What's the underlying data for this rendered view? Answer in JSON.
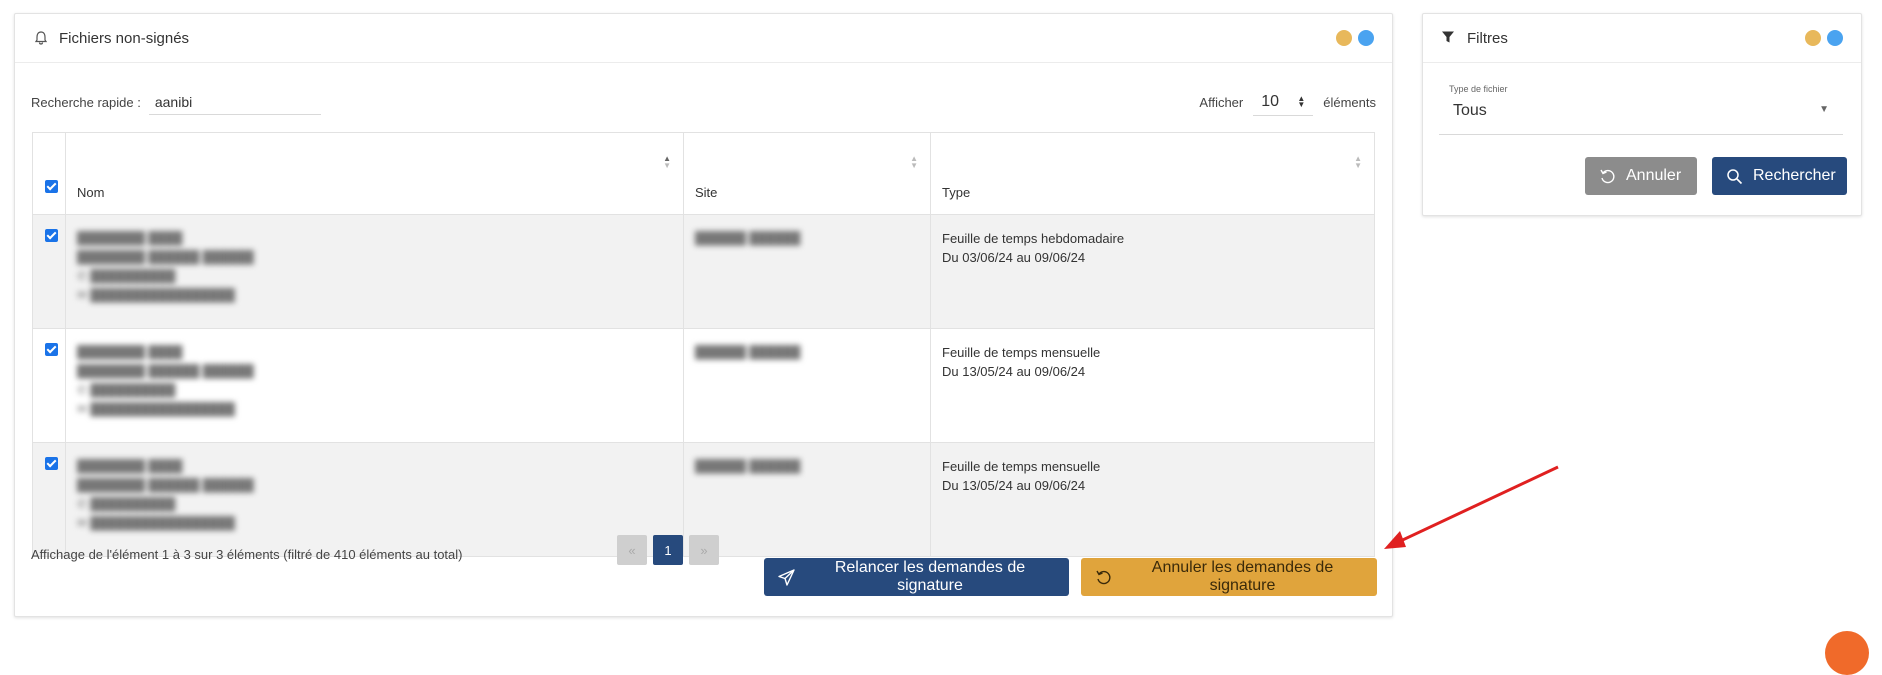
{
  "main_panel": {
    "title": "Fichiers non-signés",
    "icon": "bell-icon",
    "dot_colors": [
      "#e8b85b",
      "#4aa3f0"
    ]
  },
  "search": {
    "label": "Recherche rapide :",
    "value": "aanibi"
  },
  "page_size": {
    "prefix": "Afficher",
    "value": "10",
    "suffix": "éléments"
  },
  "table": {
    "headers": {
      "name": "Nom",
      "site": "Site",
      "type": "Type"
    },
    "rows": [
      {
        "type_line1": "Feuille de temps hebdomadaire",
        "type_line2": "Du 03/06/24 au 09/06/24"
      },
      {
        "type_line1": "Feuille de temps mensuelle",
        "type_line2": "Du 13/05/24 au 09/06/24"
      },
      {
        "type_line1": "Feuille de temps mensuelle",
        "type_line2": "Du 13/05/24 au 09/06/24"
      }
    ]
  },
  "pagination": {
    "info": "Affichage de l'élément 1 à 3 sur 3 éléments (filtré de 410 éléments au total)",
    "prev": "«",
    "current": "1",
    "next": "»"
  },
  "actions": {
    "relancer": "Relancer les demandes de signature",
    "annuler": "Annuler les demandes de signature"
  },
  "filter_panel": {
    "title": "Filtres",
    "icon": "filter-icon",
    "type_label": "Type de fichier",
    "type_value": "Tous",
    "cancel_label": "Annuler",
    "search_label": "Rechercher"
  },
  "colors": {
    "primary": "#274a7d",
    "warning": "#e0a43c",
    "arrow": "#e02020",
    "chat": "#f06a2a"
  }
}
